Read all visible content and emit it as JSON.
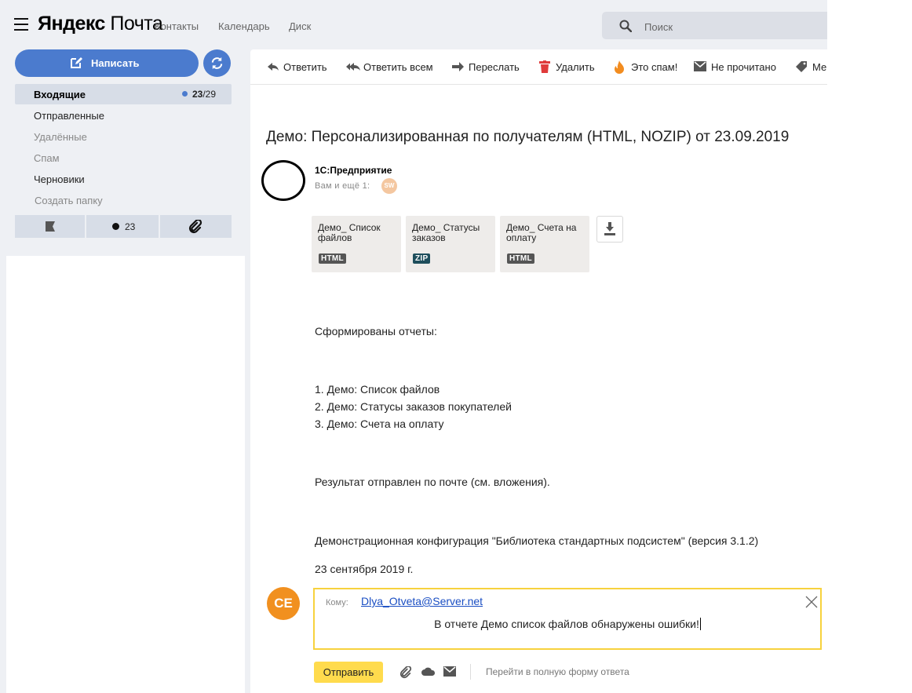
{
  "header": {
    "logo_brand": "Яндекс",
    "logo_product": "Почта",
    "nav": [
      "Контакты",
      "Календарь",
      "Диск"
    ],
    "search_placeholder": "Поиск"
  },
  "sidebar": {
    "compose_label": "Написать",
    "folders": [
      {
        "label": "Входящие",
        "count": "23",
        "total": "/29",
        "active": true
      },
      {
        "label": "Отправленные"
      },
      {
        "label": "Удалённые"
      },
      {
        "label": "Спам"
      },
      {
        "label": "Черновики"
      },
      {
        "label": "Создать папку"
      }
    ],
    "filter_unread_count": "23"
  },
  "toolbar": {
    "reply": "Ответить",
    "reply_all": "Ответить всем",
    "forward": "Переслать",
    "delete": "Удалить",
    "spam": "Это спам!",
    "unread": "Не прочитано",
    "tag": "Ме"
  },
  "message": {
    "subject": "Демо: Персонализированная по получателям (HTML, NOZIP) от 23.09.2019",
    "sender": "1С:Предприятие",
    "recipients": "Вам и ещё 1:",
    "recipient_avatar": "SW",
    "attachments": [
      {
        "name": "Демо_ Список файлов",
        "type": "HTML"
      },
      {
        "name": "Демо_ Статусы заказов",
        "type": "ZIP"
      },
      {
        "name": "Демо_ Счета на оплату",
        "type": "HTML"
      }
    ],
    "body": {
      "intro": "Сформированы отчеты:",
      "items": [
        "1. Демо: Список файлов",
        "2. Демо: Статусы заказов покупателей",
        "3. Демо: Счета на оплату"
      ],
      "result": "Результат отправлен по почте (см. вложения).",
      "config": "Демонстрационная конфигурация \"Библиотека стандартных подсистем\" (версия 3.1.2)",
      "date": "23 сентября 2019 г."
    }
  },
  "reply": {
    "avatar": "CE",
    "to_label": "Кому:",
    "to_address": "Dlya_Otveta@Server.net",
    "text": "В отчете Демо список файлов обнаружены ошибки!",
    "send_label": "Отправить",
    "full_form": "Перейти в полную форму ответа"
  },
  "colors": {
    "accent": "#4b7bce",
    "send_button": "#ffdb4d",
    "reply_border": "#f7d23e",
    "avatar_ce": "#f1901f",
    "zip_badge": "#1e4e5c",
    "html_badge": "#555555"
  }
}
